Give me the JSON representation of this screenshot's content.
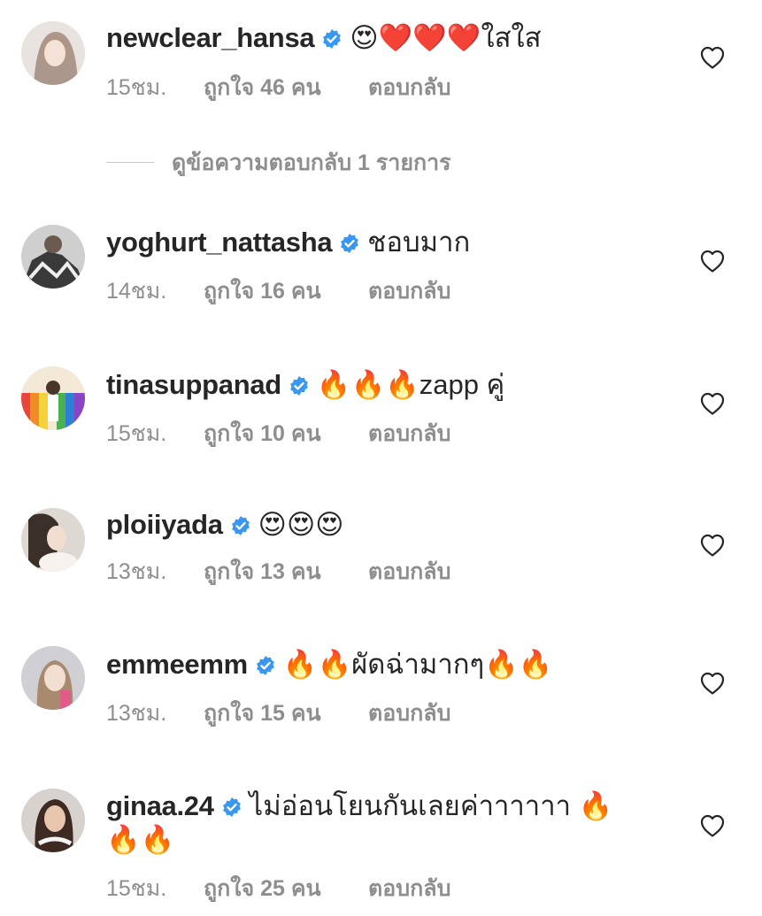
{
  "comments": [
    {
      "username": "newclear_hansa",
      "text": "😍❤️❤️❤️ใสใส",
      "text_cont": "",
      "time": "15ชม.",
      "likes": "ถูกใจ 46 คน",
      "reply": "ตอบกลับ",
      "avatar_colors": [
        "#e8e3de",
        "#7a5a48"
      ]
    },
    {
      "username": "yoghurt_nattasha",
      "text": "ชอบมาก",
      "text_cont": "",
      "time": "14ชม.",
      "likes": "ถูกใจ 16 คน",
      "reply": "ตอบกลับ",
      "avatar_colors": [
        "#5a5a5a",
        "#d8d8d8"
      ]
    },
    {
      "username": "tinasuppanad",
      "text": "🔥🔥🔥zapp คู่",
      "text_cont": "",
      "time": "15ชม.",
      "likes": "ถูกใจ 10 คน",
      "reply": "ตอบกลับ",
      "avatar_colors": [
        "#e25a7a",
        "#3a8fd8"
      ]
    },
    {
      "username": "ploiiyada",
      "text": "😍😍😍",
      "text_cont": "",
      "time": "13ชม.",
      "likes": "ถูกใจ 13 คน",
      "reply": "ตอบกลับ",
      "avatar_colors": [
        "#d9d4cf",
        "#3b2f2a"
      ]
    },
    {
      "username": "emmeemm",
      "text": "🔥🔥ผัดฉ่ามากๆ🔥🔥",
      "text_cont": "",
      "time": "13ชม.",
      "likes": "ถูกใจ 15 คน",
      "reply": "ตอบกลับ",
      "avatar_colors": [
        "#cfcfd4",
        "#a88a6e"
      ]
    },
    {
      "username": "ginaa.24",
      "text": "ไม่อ่อนโยนกันเลยค่าาาาาา 🔥",
      "text_cont": "🔥🔥",
      "time": "15ชม.",
      "likes": "ถูกใจ 25 คน",
      "reply": "ตอบกลับ",
      "avatar_colors": [
        "#d7d2cd",
        "#3d2a22"
      ]
    }
  ],
  "view_replies": "ดูข้อความตอบกลับ 1 รายการ",
  "colors": {
    "verified": "#3897f0",
    "meta": "#8e8e8e",
    "text": "#262626"
  }
}
